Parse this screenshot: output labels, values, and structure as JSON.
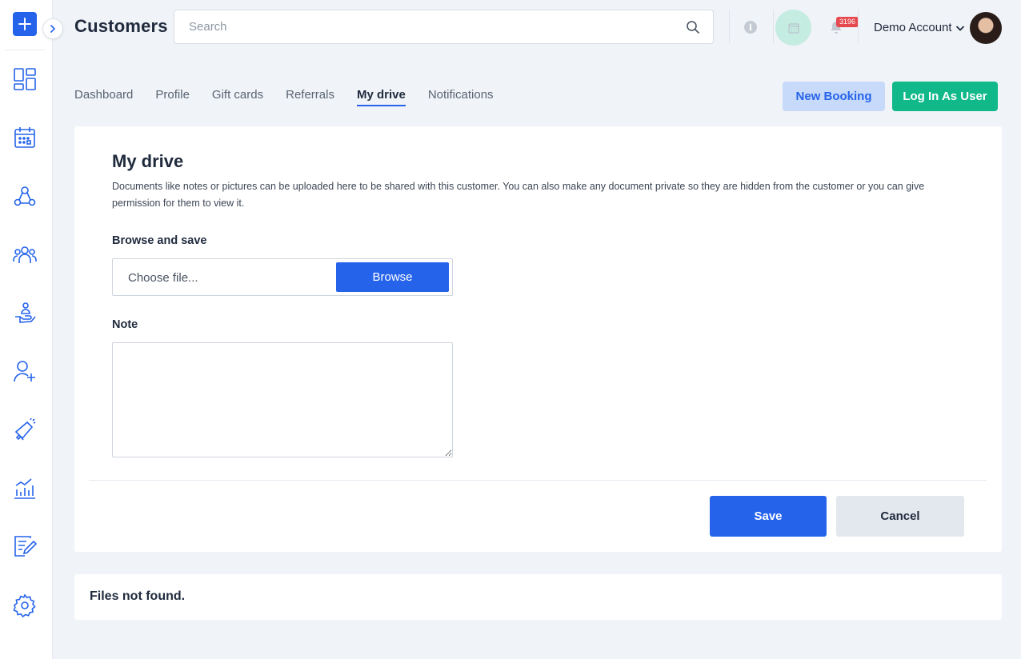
{
  "app": {
    "accent_color": "#2563eb",
    "success_color": "#10b88a"
  },
  "header": {
    "title": "Customers",
    "search_placeholder": "Search",
    "notification_count": "3196",
    "account_name": "Demo Account"
  },
  "sidebar": {
    "items": [
      {
        "icon": "dashboard-icon"
      },
      {
        "icon": "calendar-icon"
      },
      {
        "icon": "network-icon"
      },
      {
        "icon": "customers-icon"
      },
      {
        "icon": "services-icon"
      },
      {
        "icon": "add-user-icon"
      },
      {
        "icon": "marketing-icon"
      },
      {
        "icon": "reports-icon"
      },
      {
        "icon": "notes-edit-icon"
      },
      {
        "icon": "settings-icon"
      }
    ]
  },
  "tabs": [
    {
      "label": "Dashboard",
      "active": false
    },
    {
      "label": "Profile",
      "active": false
    },
    {
      "label": "Gift cards",
      "active": false
    },
    {
      "label": "Referrals",
      "active": false
    },
    {
      "label": "My drive",
      "active": true
    },
    {
      "label": "Notifications",
      "active": false
    }
  ],
  "actions": {
    "new_booking": "New Booking",
    "login_as_user": "Log In As User"
  },
  "drive": {
    "title": "My drive",
    "description": "Documents like notes or pictures can be uploaded here to be shared with this customer. You can also make any document private so they are hidden from the customer or you can give permission for them to view it.",
    "browse_label": "Browse and save",
    "file_placeholder": "Choose file...",
    "browse_button": "Browse",
    "note_label": "Note",
    "note_value": "",
    "save_button": "Save",
    "cancel_button": "Cancel"
  },
  "files": {
    "empty_message": "Files not found."
  }
}
